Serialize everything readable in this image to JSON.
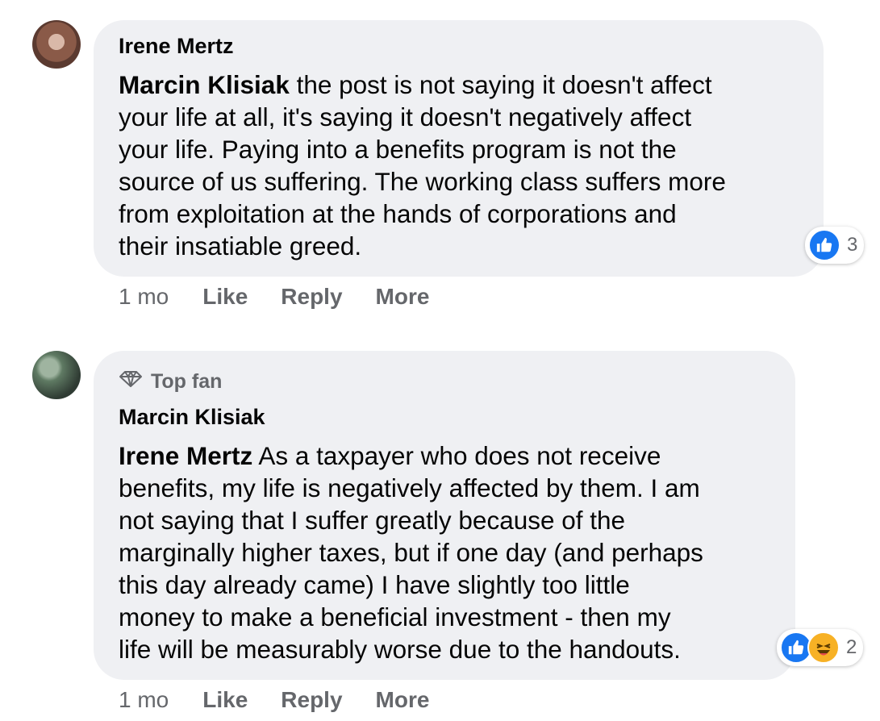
{
  "comments": [
    {
      "author": "Irene Mertz",
      "mention": "Marcin Klisiak",
      "text": " the post is not saying it doesn't affect\nyour life at all, it's saying it doesn't negatively affect\nyour life. Paying into a benefits program is not the\nsource of us suffering. The working class suffers more\nfrom exploitation at the hands of corporations and\ntheir insatiable greed.",
      "reaction_icons": [
        "like-icon"
      ],
      "reaction_count": "3",
      "time": "1 mo",
      "actions": {
        "like": "Like",
        "reply": "Reply",
        "more": "More"
      }
    },
    {
      "badge": "Top fan",
      "badge_icon": "diamond-icon",
      "author": "Marcin Klisiak",
      "mention": "Irene Mertz",
      "text": " As a taxpayer who does not receive\nbenefits, my life is negatively affected by them. I am\nnot saying that I suffer greatly because of the\nmarginally higher taxes, but if one day (and perhaps\nthis day already came) I have slightly too little\nmoney to make a beneficial investment - then my\nlife will be measurably worse due to the handouts.",
      "reaction_icons": [
        "like-icon",
        "haha-icon"
      ],
      "reaction_count": "2",
      "time": "1 mo",
      "actions": {
        "like": "Like",
        "reply": "Reply",
        "more": "More"
      }
    }
  ],
  "colors": {
    "bubble": "#eff0f3",
    "secondary_text": "#65676b",
    "like_blue": "#1877f2",
    "haha_yellow": "#f7b125"
  }
}
